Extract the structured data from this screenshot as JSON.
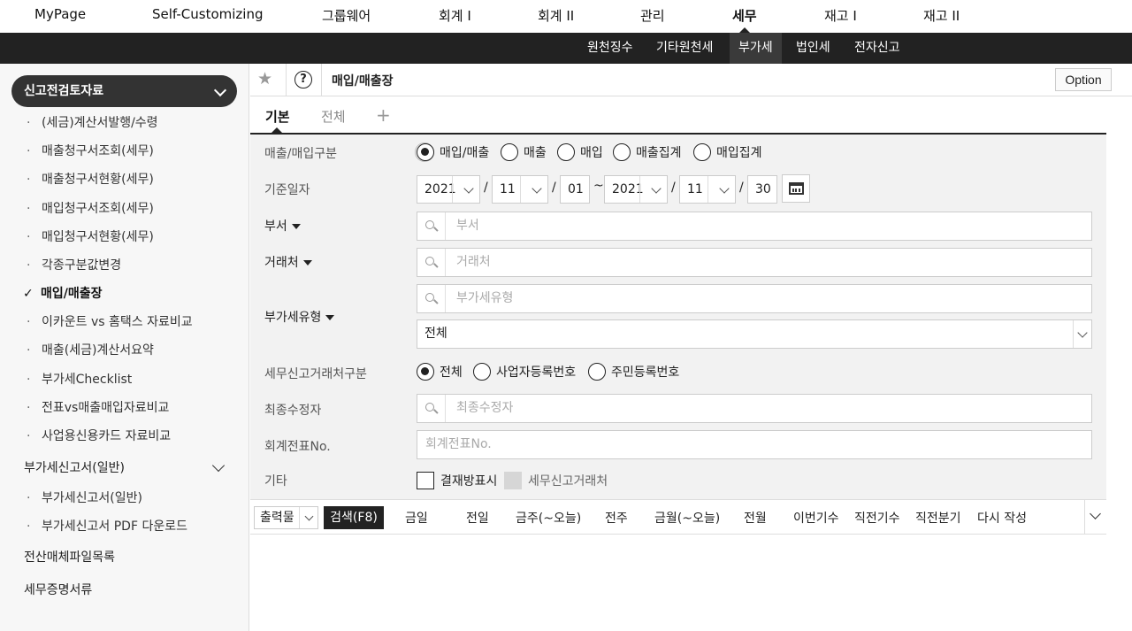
{
  "top_nav": {
    "items": [
      "MyPage",
      "Self-Customizing",
      "그룹웨어",
      "회계 I",
      "회계 II",
      "관리",
      "세무",
      "재고 I",
      "재고 II"
    ],
    "active": "세무"
  },
  "sub_nav": {
    "items": [
      "원천징수",
      "기타원천세",
      "부가세",
      "법인세",
      "전자신고"
    ],
    "active": "부가세"
  },
  "sidebar": {
    "header": "신고전검토자료",
    "items": [
      "(세금)계산서발행/수령",
      "매출청구서조회(세무)",
      "매출청구서현황(세무)",
      "매입청구서조회(세무)",
      "매입청구서현황(세무)",
      "각종구분값변경",
      "매입/매출장",
      "이카운트 vs 홈택스 자료비교",
      "매출(세금)계산서요약",
      "부가세Checklist",
      "전표vs매출매입자료비교",
      "사업용신용카드 자료비교"
    ],
    "active_item": "매입/매출장",
    "section2": "부가세신고서(일반)",
    "section2_items": [
      "부가세신고서(일반)",
      "부가세신고서 PDF 다운로드"
    ],
    "section3": "전산매체파일목록",
    "section4": "세무증명서류"
  },
  "page": {
    "title": "매입/매출장",
    "option_label": "Option"
  },
  "tabs": {
    "items": [
      "기본",
      "전체"
    ],
    "add": "+"
  },
  "form": {
    "sales_purchase": {
      "label": "매출/매입구분",
      "options": [
        "매입/매출",
        "매출",
        "매입",
        "매출집계",
        "매입집계"
      ],
      "selected": "매입/매출"
    },
    "base_date": {
      "label": "기준일자",
      "from_year": "2021",
      "from_month": "11",
      "from_day": "01",
      "tilde": "~",
      "to_year": "2021",
      "to_month": "11",
      "to_day": "30",
      "sep": "/"
    },
    "department": {
      "label": "부서",
      "placeholder": "부서"
    },
    "customer": {
      "label": "거래처",
      "placeholder": "거래처"
    },
    "vat_type": {
      "label": "부가세유형",
      "placeholder": "부가세유형",
      "select_value": "전체"
    },
    "tax_partner_type": {
      "label": "세무신고거래처구분",
      "options": [
        "전체",
        "사업자등록번호",
        "주민등록번호"
      ],
      "selected": "전체"
    },
    "last_editor": {
      "label": "최종수정자",
      "placeholder": "최종수정자"
    },
    "voucher_no": {
      "label": "회계전표No.",
      "placeholder": "회계전표No."
    },
    "etc": {
      "label": "기타",
      "checkbox1": "결재방표시",
      "checkbox2": "세무신고거래처"
    }
  },
  "action_bar": {
    "output_label": "출력물",
    "search_label": "검색(F8)",
    "quick": [
      "금일",
      "전일",
      "금주(~오늘)",
      "전주",
      "금월(~오늘)",
      "전월",
      "이번기수",
      "직전기수",
      "직전분기",
      "다시 작성"
    ]
  }
}
